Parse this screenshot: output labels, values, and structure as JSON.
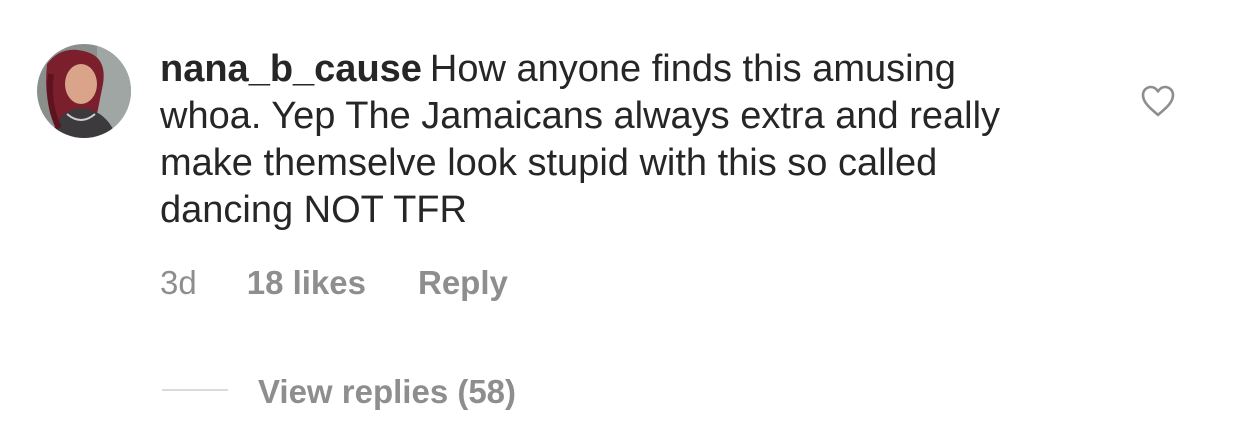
{
  "comment": {
    "username": "nana_b_cause",
    "text": "How anyone finds this amusing whoa. Yep The Jamaicans always extra and really make themselve look stupid with this so called dancing NOT TFR",
    "timestamp": "3d",
    "likes": "18 likes",
    "reply_label": "Reply",
    "view_replies_label": "View replies (58)",
    "like_icon": "heart-outline-icon"
  },
  "colors": {
    "text": "#262626",
    "secondary_text": "#8e8e8e",
    "divider": "#dbdbdb"
  }
}
